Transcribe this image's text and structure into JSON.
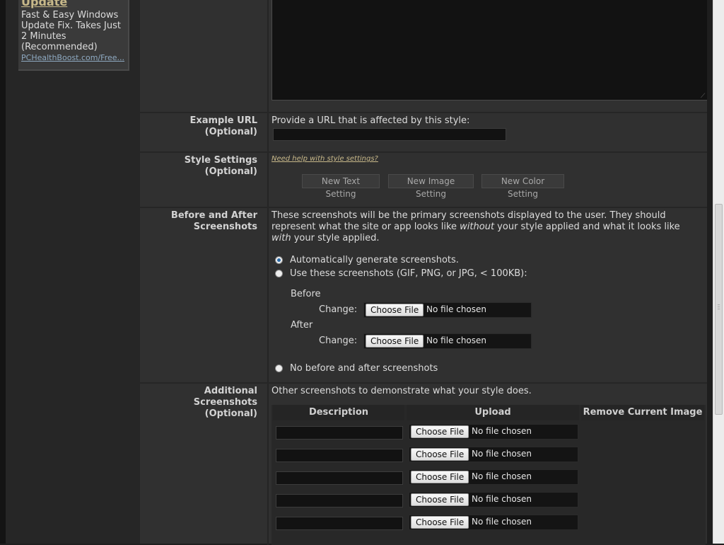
{
  "sidebar": {
    "ad": {
      "title": "Update",
      "text": "Fast & Easy Windows Update Fix. Takes Just 2 Minutes (Recommended)",
      "link": "PCHealthBoost.com/Free..."
    }
  },
  "example_url": {
    "label_line1": "Example URL",
    "label_line2": "(Optional)",
    "prompt": "Provide a URL that is affected by this style:",
    "value": ""
  },
  "style_settings": {
    "label_line1": "Style Settings",
    "label_line2": "(Optional)",
    "help_link": "Need help with style settings?",
    "buttons": [
      "New Text Setting",
      "New Image Setting",
      "New Color Setting"
    ]
  },
  "screenshots": {
    "label_line1": "Before and After",
    "label_line2": "Screenshots",
    "desc_line1": "These screenshots will be the primary screenshots displayed to the user. They should",
    "desc_line2_a": "represent what the site or app looks like ",
    "desc_line2_em": "without",
    "desc_line2_b": " your style applied and what it looks like",
    "desc_line3_em": "with",
    "desc_line3_b": " your style applied.",
    "option_auto": "Automatically generate screenshots.",
    "option_use": "Use these screenshots (GIF, PNG, or JPG, < 100KB):",
    "before_label": "Before",
    "after_label": "After",
    "change_label": "Change:",
    "choose_file": "Choose File",
    "no_file": "No file chosen",
    "option_none": "No before and after screenshots",
    "selected_option": "auto"
  },
  "additional": {
    "label_line1": "Additional Screenshots",
    "label_line2": "(Optional)",
    "description": "Other screenshots to demonstrate what your style does.",
    "headers": {
      "description": "Description",
      "upload": "Upload",
      "remove": "Remove Current Image"
    },
    "rows": [
      {
        "description": "",
        "choose": "Choose File",
        "file": "No file chosen"
      },
      {
        "description": "",
        "choose": "Choose File",
        "file": "No file chosen"
      },
      {
        "description": "",
        "choose": "Choose File",
        "file": "No file chosen"
      },
      {
        "description": "",
        "choose": "Choose File",
        "file": "No file chosen"
      },
      {
        "description": "",
        "choose": "Choose File",
        "file": "No file chosen"
      }
    ]
  },
  "colors": {
    "page_bg": "#303030",
    "input_bg": "#121212",
    "link": "#c9b98a"
  }
}
